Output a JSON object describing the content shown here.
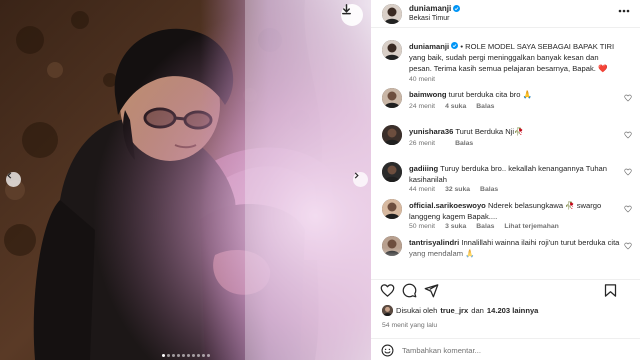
{
  "post": {
    "username": "duniamanji",
    "location": "Bekasi Timur",
    "caption": "• ROLE MODEL SAYA SEBAGAI BAPAK TIRI yang baik, sudah pergi meninggalkan banyak kesan dan pesan. Terima kasih semua pelajaran besarnya, Bapak. ❤️",
    "caption_time": "40 menit"
  },
  "comments": [
    {
      "username": "baimwong",
      "text": "turut berduka cita bro 🙏",
      "time": "24 menit",
      "likes": "4 suka",
      "reply": "Balas",
      "translate": ""
    },
    {
      "username": "yunishara36",
      "text": "Turut Berduka Nji🥀",
      "time": "26 menit",
      "likes": "",
      "reply": "Balas",
      "translate": ""
    },
    {
      "username": "gadiiing",
      "text": "Turuy berduka bro.. kekallah kenangannya Tuhan kasihanilah",
      "time": "44 menit",
      "likes": "32 suka",
      "reply": "Balas",
      "translate": ""
    },
    {
      "username": "official.sarikoeswoyo",
      "text": "Nderek belasungkawa 🥀 swargo langgeng kagem Bapak....",
      "time": "50 menit",
      "likes": "3 suka",
      "reply": "Balas",
      "translate": "Lihat terjemahan"
    },
    {
      "username": "tantrisyalindri",
      "text": "Innalillahi wainna ilaihi roji'un turut berduka cita yang mendalam 🙏",
      "time": "",
      "likes": "",
      "reply": "",
      "translate": ""
    }
  ],
  "likes": {
    "prefix": "Disukai oleh",
    "user": "true_jrx",
    "middle": "dan",
    "count": "14.203 lainnya"
  },
  "time_ago": "54 menit yang lalu",
  "add_comment": {
    "placeholder": "Tambahkan komentar..."
  },
  "carousel": {
    "total": 10,
    "active_index": 0
  },
  "icons": {
    "download": "download-icon",
    "prev": "chevron-left-icon",
    "next": "chevron-right-icon",
    "more": "more-horizontal-icon",
    "like": "heart-icon",
    "comment": "comment-icon",
    "share": "send-icon",
    "save": "bookmark-icon",
    "emoji": "emoji-icon"
  },
  "colors": {
    "verified": "#0095f6",
    "heart_caption": "#ed4956",
    "secondary_text": "#737373"
  }
}
